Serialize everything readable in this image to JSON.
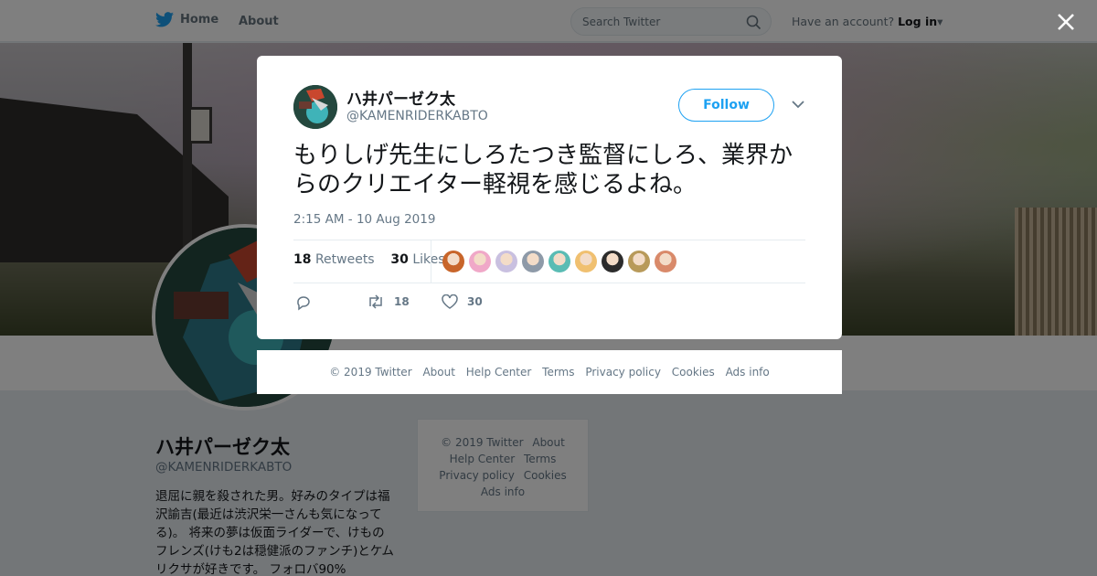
{
  "nav": {
    "home": "Home",
    "about": "About"
  },
  "search": {
    "placeholder": "Search Twitter"
  },
  "account": {
    "prompt": "Have an account?",
    "login": "Log in"
  },
  "profile": {
    "name": "ハ井パーゼク太",
    "handle": "@KAMENRIDERKABTO",
    "bio": "退屈に親を殺された男。好みのタイプは福沢諭吉(最近は渋沢栄一さんも気になってる)。 将来の夢は仮面ライダーで、けものフレンズ(けも2は穏健派のファンチ)とケムリクサが好きです。 フォロバ90%"
  },
  "tweet": {
    "author_name": "ハ井パーゼク太",
    "author_handle": "@KAMENRIDERKABTO",
    "follow_label": "Follow",
    "text": "もりしげ先生にしろたつき監督にしろ、業界からのクリエイター軽視を感じるよね。",
    "timestamp": "2:15 AM - 10 Aug 2019",
    "retweets_count": "18",
    "retweets_label": "Retweets",
    "likes_count": "30",
    "likes_label": "Likes",
    "action_retweets": "18",
    "action_likes": "30",
    "liker_avatar_colors": [
      "#c8652a",
      "#f0a8c8",
      "#c9c0e0",
      "#8e9aa8",
      "#5abcb4",
      "#f0c070",
      "#2c2c2c",
      "#b89a5a",
      "#d98a6a"
    ]
  },
  "footer": {
    "links": [
      "© 2019 Twitter",
      "About",
      "Help Center",
      "Terms",
      "Privacy policy",
      "Cookies",
      "Ads info"
    ]
  },
  "colors": {
    "accent": "#1da1f2",
    "muted": "#657786"
  }
}
